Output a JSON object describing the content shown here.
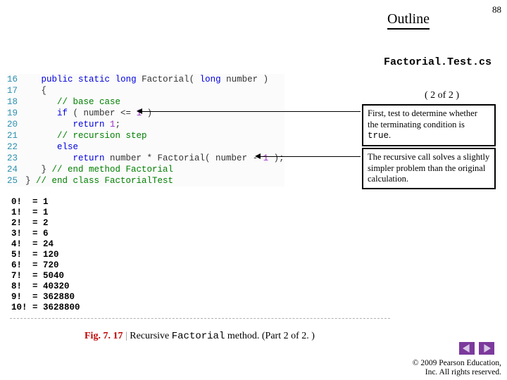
{
  "page_number": "88",
  "outline_title": "Outline",
  "source_file": "Factorial.Test.cs",
  "part_label": "( 2 of 2 )",
  "code_lines": [
    {
      "n": "16",
      "kw1": "public static",
      "kw2": "long",
      "name": " Factorial( ",
      "kw3": "long",
      "rest": " number )"
    },
    {
      "n": "17",
      "plain": "{"
    },
    {
      "n": "18",
      "comment": "// base case"
    },
    {
      "n": "19",
      "kw": "if",
      "plain1": " ( number <= ",
      "num": "1",
      "plain2": " )"
    },
    {
      "n": "20",
      "kw": "return",
      "plain1": " ",
      "num": "1",
      "plain2": ";"
    },
    {
      "n": "21",
      "comment": "// recursion step"
    },
    {
      "n": "22",
      "kw": "else",
      "plain1": "",
      "plain2": ""
    },
    {
      "n": "23",
      "kw": "return",
      "plain1": " number * Factorial( number - ",
      "num": "1",
      "plain2": " );"
    },
    {
      "n": "24",
      "plain1": "} ",
      "comment": "// end method Factorial"
    },
    {
      "n": "25",
      "plain1": "} ",
      "comment": "// end class FactorialTest"
    }
  ],
  "notes": {
    "n1a": "First, test to determine whether the terminating condition is ",
    "n1b": "true",
    "n1c": ".",
    "n2": "The recursive call solves a slightly simpler problem than the original calculation."
  },
  "output": [
    "0!  = 1",
    "1!  = 1",
    "2!  = 2",
    "3!  = 6",
    "4!  = 24",
    "5!  = 120",
    "6!  = 720",
    "7!  = 5040",
    "8!  = 40320",
    "9!  = 362880",
    "10! = 3628800"
  ],
  "caption": {
    "figlabel": "Fig. 7. 17",
    "bar": " | ",
    "pre": "Recursive ",
    "mono": "Factorial",
    "post": " method. (Part 2 of 2. )"
  },
  "copyright": {
    "line1": "© 2009 Pearson Education,",
    "line2": "Inc.  All rights reserved."
  },
  "icons": {
    "prev": "prev-triangle",
    "next": "next-triangle"
  },
  "colors": {
    "keyword": "#0000e0",
    "number": "#9b2fc5",
    "comment": "#008000",
    "linenum": "#2b91af",
    "accent": "#7c3a9c",
    "fig": "#c00000"
  }
}
